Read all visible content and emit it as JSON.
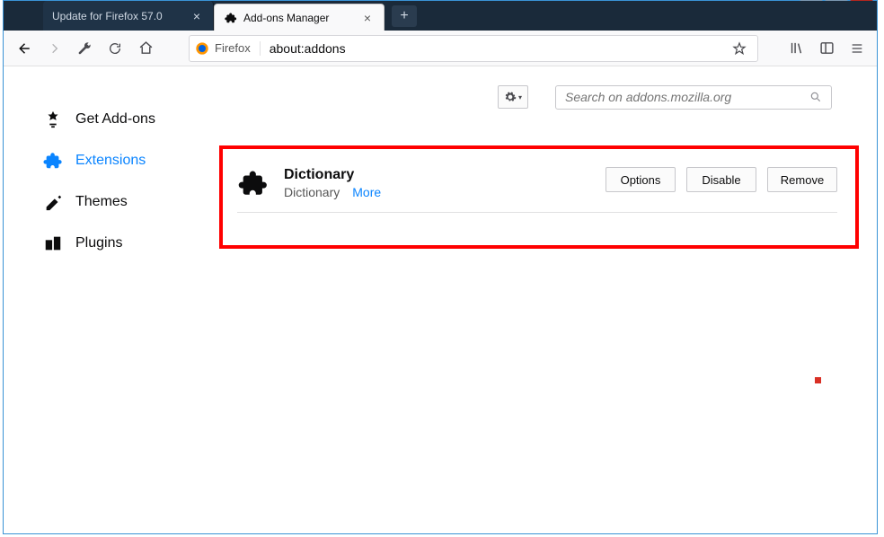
{
  "window": {
    "minimize_title": "Minimize",
    "maximize_title": "Maximize",
    "close_title": "Close"
  },
  "tabs": {
    "tab0": {
      "label": "Update for Firefox 57.0"
    },
    "tab1": {
      "label": "Add-ons Manager"
    },
    "new_tab_title": "New Tab"
  },
  "toolbar": {
    "identity_label": "Firefox",
    "url": "about:addons",
    "back_title": "Back",
    "forward_title": "Forward",
    "action_title": "Page actions",
    "reload_title": "Reload",
    "home_title": "Home",
    "bookmark_title": "Bookmark",
    "library_title": "Library",
    "sidebars_title": "Sidebars",
    "menu_title": "Menu"
  },
  "sidebar": {
    "items": [
      {
        "label": "Get Add-ons"
      },
      {
        "label": "Extensions"
      },
      {
        "label": "Themes"
      },
      {
        "label": "Plugins"
      }
    ]
  },
  "panel": {
    "gear_title": "Tools",
    "search_placeholder": "Search on addons.mozilla.org"
  },
  "addon": {
    "name": "Dictionary",
    "description": "Dictionary",
    "more_label": "More",
    "options_label": "Options",
    "disable_label": "Disable",
    "remove_label": "Remove"
  }
}
